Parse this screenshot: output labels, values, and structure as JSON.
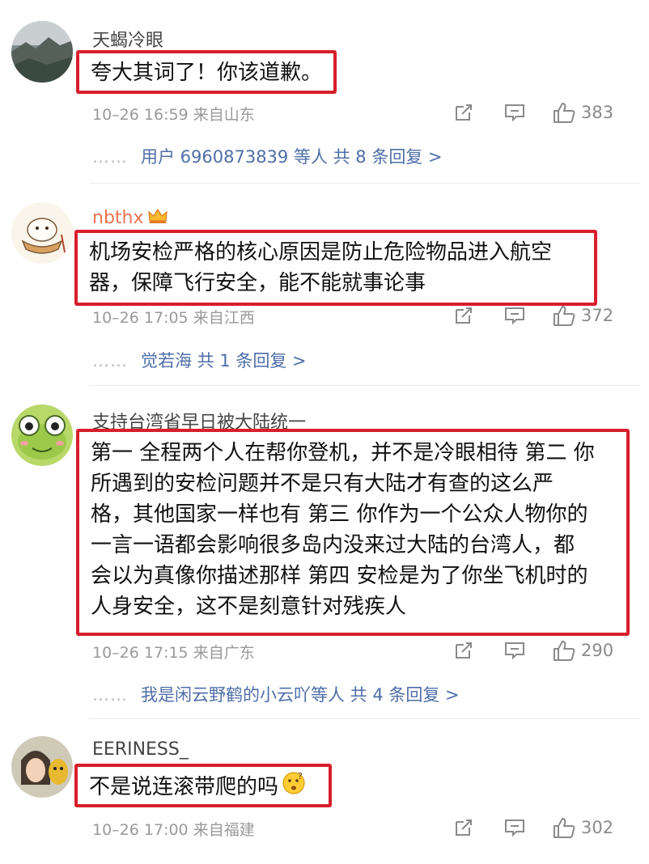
{
  "comments": [
    {
      "username": "天蝎冷眼",
      "text_lines": [
        "夸大其词了！你该道歉。"
      ],
      "meta": "10–26 16:59 来自山东",
      "likes": "383",
      "replies": "用户 6960873839 等人  共 8 条回复 >"
    },
    {
      "username": "nbthx",
      "text_lines": [
        "机场安检严格的核心原因是防止危险物品进入航空",
        "器，保障飞行安全，能不能就事论事"
      ],
      "meta": "10–26 17:05 来自江西",
      "likes": "372",
      "replies": "觉若海  共 1 条回复 >"
    },
    {
      "username": "支持台湾省早日被大陆统一",
      "text_lines": [
        "第一 全程两个人在帮你登机，并不是冷眼相待 第二 你",
        "所遇到的安检问题并不是只有大陆才有查的这么严",
        "格，其他国家一样也有 第三 你作为一个公众人物你的",
        "一言一语都会影响很多岛内没来过大陆的台湾人，都",
        "会以为真像你描述那样 第四 安检是为了你坐飞机时的",
        "人身安全，这不是刻意针对残疾人"
      ],
      "meta": "10–26 17:15 来自广东",
      "likes": "290",
      "replies": "我是闲云野鹤的小云吖等人  共 4 条回复 >"
    },
    {
      "username": "EERINESS_",
      "text_lines": [
        "不是说连滚带爬的吗"
      ],
      "meta": "10–26 17:00 来自福建",
      "likes": "302"
    }
  ],
  "icons": {
    "share": "share-icon",
    "comment": "comment-icon",
    "like": "like-icon",
    "vip": "crown-icon",
    "emoji": "thinking-emoji-icon"
  },
  "colors": {
    "highlight_border": "#d81e2c",
    "reply_link": "#4e6ea8",
    "vip_username": "#eb7350",
    "meta_text": "#9a9a9a"
  }
}
